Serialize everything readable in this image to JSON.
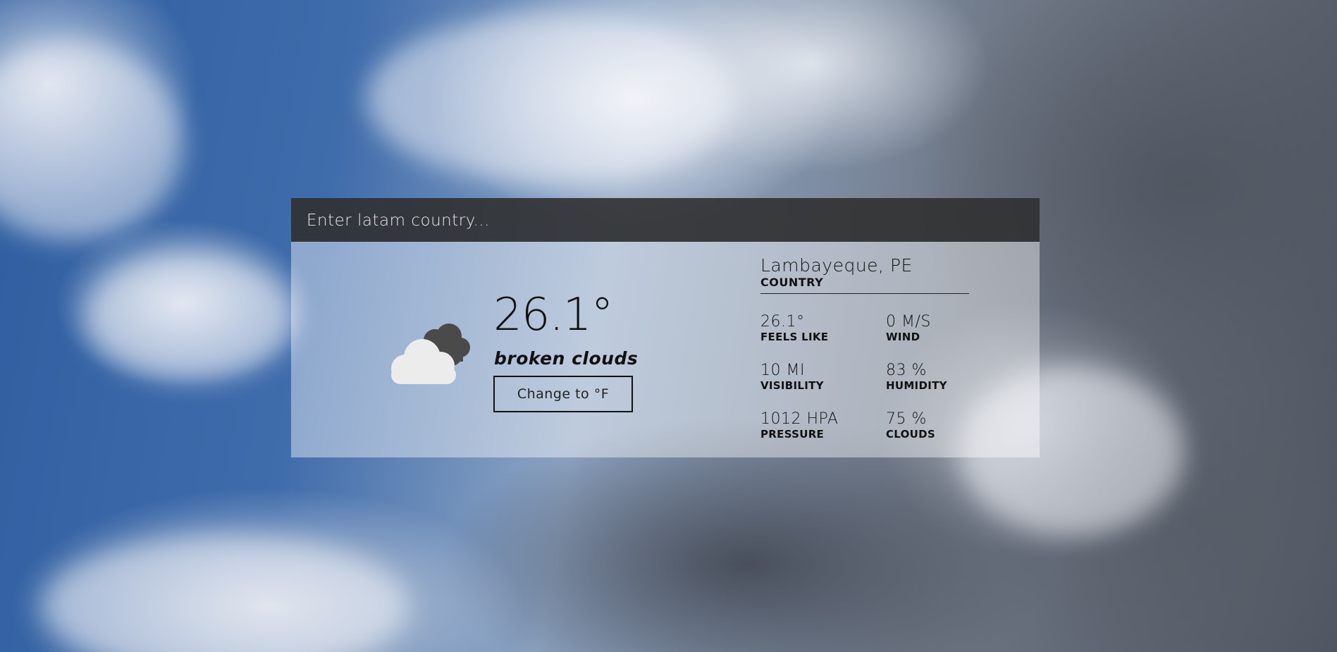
{
  "search": {
    "placeholder": "Enter latam country..."
  },
  "current": {
    "temperature": "26.1°",
    "description": "broken clouds",
    "unit_button_label": "Change to °F",
    "icon": "broken-clouds-icon"
  },
  "location": {
    "name": "Lambayeque, PE",
    "label": "COUNTRY"
  },
  "stats": [
    {
      "value": "26.1°",
      "label": "FEELS LIKE"
    },
    {
      "value": "0 M/S",
      "label": "WIND"
    },
    {
      "value": "10 MI",
      "label": "VISIBILITY"
    },
    {
      "value": "83 %",
      "label": "HUMIDITY"
    },
    {
      "value": "1012 HPA",
      "label": "PRESSURE"
    },
    {
      "value": "75 %",
      "label": "CLOUDS"
    }
  ],
  "colors": {
    "search_bar_bg": "#1c1c1c",
    "card_bg": "#ffffff",
    "text": "#111111"
  }
}
